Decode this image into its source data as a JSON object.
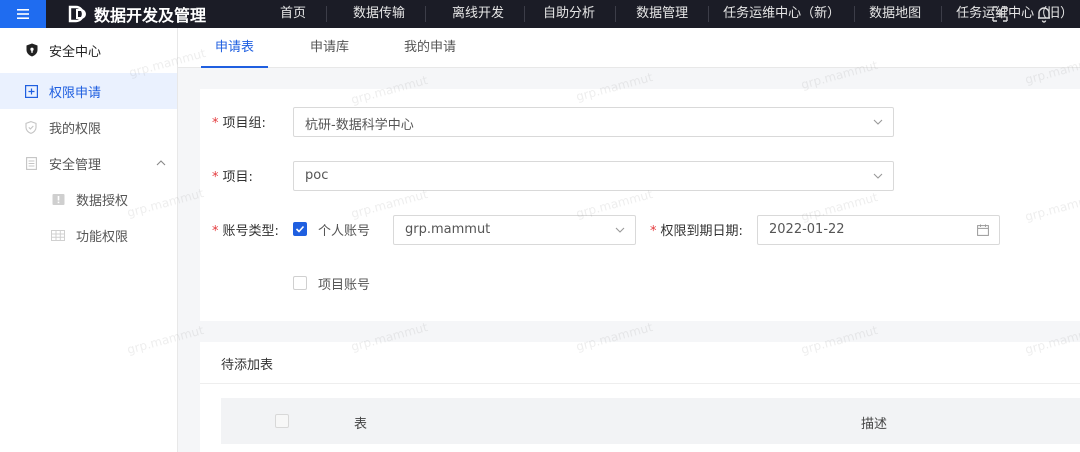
{
  "app": {
    "title": "数据开发及管理"
  },
  "topnav": [
    "首页",
    "数据传输",
    "离线开发",
    "自助分析",
    "数据管理",
    "任务运维中心（新）",
    "数据地图",
    "任务运维中心（旧）"
  ],
  "sidebar": {
    "title": "安全中心",
    "items": [
      {
        "label": "权限申请",
        "icon": "plus-square-icon",
        "active": true
      },
      {
        "label": "我的权限",
        "icon": "shield-icon",
        "active": false
      },
      {
        "label": "安全管理",
        "icon": "document-icon",
        "active": false,
        "expanded": true
      },
      {
        "label": "数据授权",
        "icon": "badge-icon",
        "active": false
      },
      {
        "label": "功能权限",
        "icon": "table-icon",
        "active": false
      }
    ]
  },
  "tabs": [
    {
      "label": "申请表",
      "active": true
    },
    {
      "label": "申请库",
      "active": false
    },
    {
      "label": "我的申请",
      "active": false
    }
  ],
  "form": {
    "project_group_label": "项目组:",
    "project_group_value": "杭研-数据科学中心",
    "project_label": "项目:",
    "project_value": "poc",
    "account_type_label": "账号类型:",
    "personal_account_label": "个人账号",
    "personal_account_checked": true,
    "personal_account_value": "grp.mammut",
    "expire_label": "权限到期日期:",
    "expire_value": "2022-01-22",
    "project_account_label": "项目账号",
    "project_account_checked": false
  },
  "table": {
    "title": "待添加表",
    "columns": [
      "表",
      "描述"
    ]
  },
  "watermark": "grp.mammut",
  "colors": {
    "accent": "#1f5fe0",
    "topbar": "#1b1c26",
    "required": "#e4393c"
  }
}
